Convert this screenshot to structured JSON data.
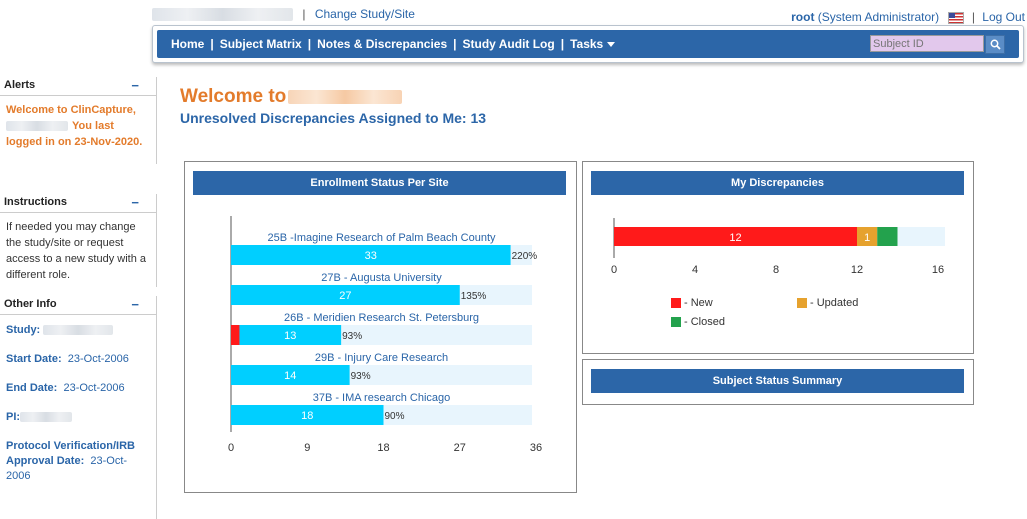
{
  "top": {
    "separator": "|",
    "change_study": "Change Study/Site",
    "user": "root",
    "role": "(System Administrator)",
    "logout": "Log Out"
  },
  "nav": {
    "items": [
      "Home",
      "Subject Matrix",
      "Notes & Discrepancies",
      "Study Audit Log",
      "Tasks"
    ],
    "search_placeholder": "Subject ID"
  },
  "sidebar": {
    "alerts_title": "Alerts",
    "alerts_text_1": "Welcome to ClinCapture,",
    "alerts_text_2": "You last",
    "alerts_text_3": "logged in on 23-Nov-2020.",
    "instructions_title": "Instructions",
    "instructions_text": "If needed you may change the study/site or request access to a new study with a different role.",
    "other_title": "Other Info",
    "study_label": "Study:",
    "start_label": "Start Date:",
    "start_value": "23-Oct-2006",
    "end_label": "End Date:",
    "end_value": "23-Oct-2006",
    "pi_label": "PI:",
    "protocol_label": "Protocol Verification/IRB Approval Date:",
    "protocol_value": "23-Oct-2006",
    "collapse_symbol": "−"
  },
  "main": {
    "welcome": "Welcome to",
    "unresolved": "Unresolved Discrepancies Assigned to Me: 13",
    "enrollment_title": "Enrollment Status Per Site",
    "discrepancies_title": "My Discrepancies",
    "subject_status_title": "Subject Status Summary"
  },
  "colors": {
    "brand_blue": "#2c66a8",
    "accent_orange": "#e37b2b",
    "bar_cyan": "#00cfff",
    "bar_bg": "#e8f5fd",
    "new_red": "#ff1a1a",
    "updated_orange": "#e6a22e",
    "closed_green": "#23a24d"
  },
  "chart_data": [
    {
      "type": "bar",
      "orientation": "horizontal",
      "title": "Enrollment Status Per Site",
      "categories": [
        "25B -Imagine Research of Palm Beach County",
        "27B - Augusta University",
        "26B - Meridien Research St. Petersburg",
        "29B - Injury Care Research",
        "37B - IMA research Chicago"
      ],
      "values": [
        33,
        27,
        13,
        14,
        18
      ],
      "red_values": [
        0,
        0,
        1,
        0,
        0
      ],
      "percent_labels": [
        "220%",
        "135%",
        "93%",
        "93%",
        "90%"
      ],
      "xlim": [
        0,
        36
      ],
      "xticks": [
        0,
        9,
        18,
        27,
        36
      ]
    },
    {
      "type": "bar",
      "orientation": "horizontal",
      "stacked": true,
      "title": "My Discrepancies",
      "series": [
        {
          "name": "New",
          "values": [
            12
          ],
          "label": "12",
          "color": "#ff1a1a"
        },
        {
          "name": "Updated",
          "values": [
            1
          ],
          "label": "1",
          "color": "#e6a22e"
        },
        {
          "name": "Closed",
          "values": [
            1
          ],
          "label": "",
          "color": "#23a24d"
        }
      ],
      "legend_prefix": "- ",
      "xlim": [
        0,
        16
      ],
      "xticks": [
        0,
        4,
        8,
        12,
        16
      ]
    }
  ]
}
